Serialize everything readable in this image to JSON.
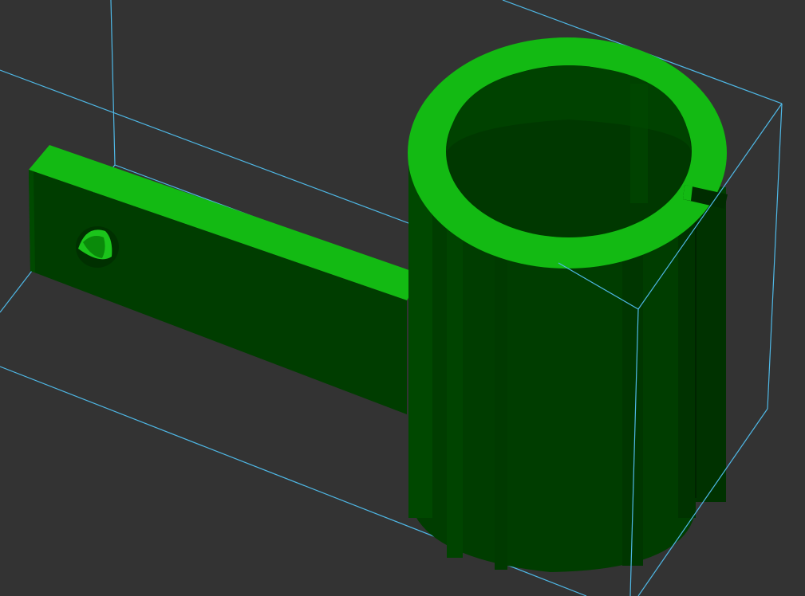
{
  "viewport": {
    "background_color": "#333333",
    "bounding_box_color": "#4fb8e6",
    "model_face_top_color": "#13ba13",
    "model_face_side_color": "#003d00",
    "model_face_mid_color": "#004c00",
    "model_inner_color": "#003200"
  },
  "model": {
    "parts": [
      "arm-with-hole",
      "cylindrical-clamp-with-slot"
    ]
  }
}
